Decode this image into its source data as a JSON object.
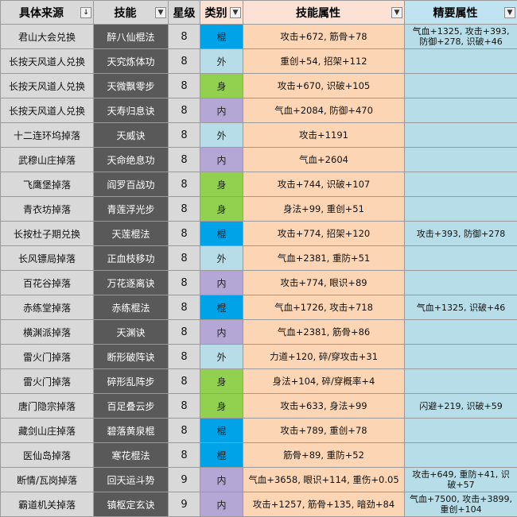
{
  "headers": [
    {
      "label": "具体来源",
      "filter": "↓"
    },
    {
      "label": "技能",
      "filter": "▼"
    },
    {
      "label": "星级",
      "filter": ""
    },
    {
      "label": "类别",
      "filter": "▼"
    },
    {
      "label": "技能属性",
      "filter": "▼"
    },
    {
      "label": "精要属性",
      "filter": "▼"
    }
  ],
  "type_colors": {
    "棍": "#00a2e8",
    "外": "#b7dee8",
    "身": "#92d050",
    "内": "#b4a7d6"
  },
  "rows": [
    {
      "source": "君山大会兑换",
      "skill": "醉八仙棍法",
      "star": "8",
      "type": "棍",
      "attr": "攻击+672, 筋骨+78",
      "essence": [
        "气血+1325, 攻击+393,",
        "防御+278, 识破+46"
      ]
    },
    {
      "source": "长按天风道人兑换",
      "skill": "天究炼体功",
      "star": "8",
      "type": "外",
      "attr": "重创+54, 招架+112",
      "essence": []
    },
    {
      "source": "长按天风道人兑换",
      "skill": "天微飘零步",
      "star": "8",
      "type": "身",
      "attr": "攻击+670, 识破+105",
      "essence": []
    },
    {
      "source": "长按天风道人兑换",
      "skill": "天寿归息诀",
      "star": "8",
      "type": "内",
      "attr": "气血+2084, 防御+470",
      "essence": []
    },
    {
      "source": "十二连环坞掉落",
      "skill": "天威诀",
      "star": "8",
      "type": "外",
      "attr": "攻击+1191",
      "essence": []
    },
    {
      "source": "武穆山庄掉落",
      "skill": "天命绝息功",
      "star": "8",
      "type": "内",
      "attr": "气血+2604",
      "essence": []
    },
    {
      "source": "飞鹰堡掉落",
      "skill": "阎罗百战功",
      "star": "8",
      "type": "身",
      "attr": "攻击+744, 识破+107",
      "essence": []
    },
    {
      "source": "青衣坊掉落",
      "skill": "青莲浮光步",
      "star": "8",
      "type": "身",
      "attr": "身法+99, 重创+51",
      "essence": []
    },
    {
      "source": "长按杜子期兑换",
      "skill": "天莲棍法",
      "star": "8",
      "type": "棍",
      "attr": "攻击+774, 招架+120",
      "essence": [
        "攻击+393, 防御+278"
      ]
    },
    {
      "source": "长风镖局掉落",
      "skill": "正血枝移功",
      "star": "8",
      "type": "外",
      "attr": "气血+2381, 重防+51",
      "essence": []
    },
    {
      "source": "百花谷掉落",
      "skill": "万花逐离诀",
      "star": "8",
      "type": "内",
      "attr": "攻击+774, 眼识+89",
      "essence": []
    },
    {
      "source": "赤练堂掉落",
      "skill": "赤练棍法",
      "star": "8",
      "type": "棍",
      "attr": "气血+1726, 攻击+718",
      "essence": [
        "气血+1325, 识破+46"
      ]
    },
    {
      "source": "横渊派掉落",
      "skill": "天渊诀",
      "star": "8",
      "type": "内",
      "attr": "气血+2381, 筋骨+86",
      "essence": []
    },
    {
      "source": "雷火门掉落",
      "skill": "断形破阵诀",
      "star": "8",
      "type": "外",
      "attr": "力道+120, 碎/穿攻击+31",
      "essence": []
    },
    {
      "source": "雷火门掉落",
      "skill": "碎形乱阵步",
      "star": "8",
      "type": "身",
      "attr": "身法+104, 碎/穿概率+4",
      "essence": []
    },
    {
      "source": "唐门隐宗掉落",
      "skill": "百足叠云步",
      "star": "8",
      "type": "身",
      "attr": "攻击+633, 身法+99",
      "essence": [
        "闪避+219, 识破+59"
      ]
    },
    {
      "source": "藏剑山庄掉落",
      "skill": "碧落黄泉棍",
      "star": "8",
      "type": "棍",
      "attr": "攻击+789, 重创+78",
      "essence": []
    },
    {
      "source": "医仙岛掉落",
      "skill": "寒花棍法",
      "star": "8",
      "type": "棍",
      "attr": "筋骨+89, 重防+52",
      "essence": []
    },
    {
      "source": "断情/瓦岗掉落",
      "skill": "回天运斗势",
      "star": "9",
      "type": "内",
      "attr": "气血+3658, 眼识+114, 重伤+0.05",
      "essence": [
        "攻击+649, 重防+41, 识",
        "破+57"
      ]
    },
    {
      "source": "霸道机关掉落",
      "skill": "镇枢定玄诀",
      "star": "9",
      "type": "内",
      "attr": "攻击+1257, 筋骨+135, 暗劲+84",
      "essence": [
        "气血+7500, 攻击+3899,",
        "重创+104"
      ]
    }
  ]
}
